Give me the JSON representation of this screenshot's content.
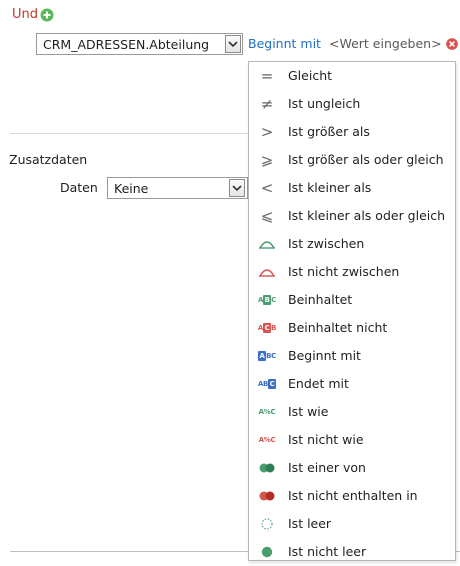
{
  "header": {
    "und_label": "Und"
  },
  "condition": {
    "field_value": "CRM_ADRESSEN.Abteilung",
    "operator_link": "Beginnt mit",
    "value_placeholder": "<Wert eingeben>"
  },
  "section": {
    "title": "Zusatzdaten",
    "daten_label": "Daten",
    "daten_value": "Keine"
  },
  "operator_menu": {
    "items": [
      {
        "label": "Gleicht",
        "icon": "equals-icon"
      },
      {
        "label": "Ist ungleich",
        "icon": "not-equal-icon"
      },
      {
        "label": "Ist größer als",
        "icon": "greater-than-icon"
      },
      {
        "label": "Ist größer als oder gleich",
        "icon": "greater-equal-icon"
      },
      {
        "label": "Ist kleiner als",
        "icon": "less-than-icon"
      },
      {
        "label": "Ist kleiner als oder gleich",
        "icon": "less-equal-icon"
      },
      {
        "label": "Ist zwischen",
        "icon": "between-icon"
      },
      {
        "label": "Ist nicht zwischen",
        "icon": "not-between-icon"
      },
      {
        "label": "Beinhaltet",
        "icon": "contains-icon"
      },
      {
        "label": "Beinhaltet nicht",
        "icon": "not-contains-icon"
      },
      {
        "label": "Beginnt mit",
        "icon": "begins-with-icon"
      },
      {
        "label": "Endet mit",
        "icon": "ends-with-icon"
      },
      {
        "label": "Ist wie",
        "icon": "like-icon"
      },
      {
        "label": "Ist nicht wie",
        "icon": "not-like-icon"
      },
      {
        "label": "Ist einer von",
        "icon": "in-list-icon"
      },
      {
        "label": "Ist nicht enthalten in",
        "icon": "not-in-list-icon"
      },
      {
        "label": "Ist leer",
        "icon": "is-empty-icon"
      },
      {
        "label": "Ist nicht leer",
        "icon": "is-not-empty-icon"
      }
    ]
  },
  "colors": {
    "accent_green": "#4a9e6e",
    "accent_red": "#d9534f",
    "accent_blue": "#3b6fc4",
    "link_blue": "#1f6fc7",
    "und_red": "#c0392b"
  }
}
